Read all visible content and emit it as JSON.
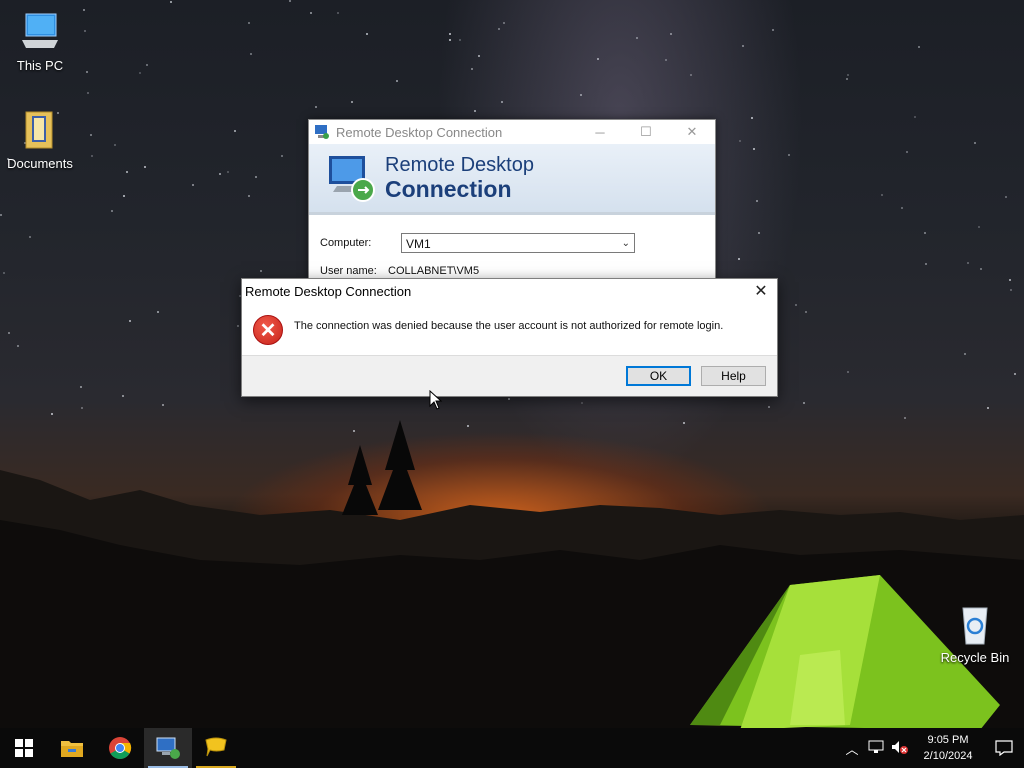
{
  "desktop": {
    "icons": [
      {
        "label": "This PC",
        "icon": "computer-icon"
      },
      {
        "label": "Documents",
        "icon": "folder-icon"
      },
      {
        "label": "Recycle Bin",
        "icon": "recycle-bin-icon"
      }
    ]
  },
  "rdp_window": {
    "title": "Remote Desktop Connection",
    "banner_line1": "Remote Desktop",
    "banner_line2": "Connection",
    "computer_label": "Computer:",
    "computer_value": "VM1",
    "username_label": "User name:",
    "username_value": "COLLABNET\\VM5"
  },
  "error_dialog": {
    "title": "Remote Desktop Connection",
    "message": "The connection was denied because the user account is not authorized for remote login.",
    "ok_label": "OK",
    "help_label": "Help",
    "icon": "error-icon"
  },
  "taskbar": {
    "apps": [
      "start-icon",
      "file-explorer-icon",
      "chrome-icon",
      "remote-desktop-icon",
      "chat-icon"
    ],
    "clock_time": "9:05 PM",
    "clock_date": "2/10/2024",
    "colors": {
      "background": "#0a0a0a",
      "active_underline": "#9bbde6"
    }
  }
}
